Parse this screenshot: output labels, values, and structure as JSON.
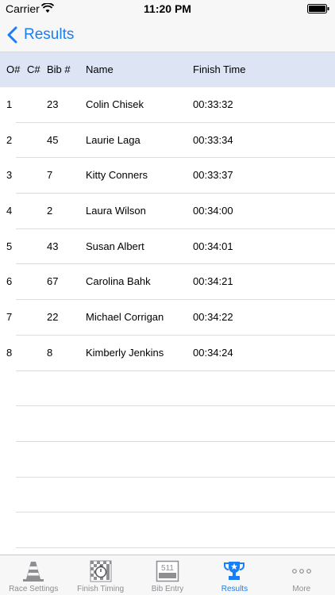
{
  "status_bar": {
    "carrier": "Carrier",
    "time": "11:20 PM"
  },
  "nav": {
    "back_label": "Results"
  },
  "table": {
    "headers": {
      "order": "O#",
      "class": "C#",
      "bib": "Bib #",
      "name": "Name",
      "finish_time": "Finish Time"
    },
    "rows": [
      {
        "order": "1",
        "class": "",
        "bib": "23",
        "name": "Colin Chisek",
        "finish_time": "00:33:32"
      },
      {
        "order": "2",
        "class": "",
        "bib": "45",
        "name": "Laurie Laga",
        "finish_time": "00:33:34"
      },
      {
        "order": "3",
        "class": "",
        "bib": "7",
        "name": "Kitty Conners",
        "finish_time": "00:33:37"
      },
      {
        "order": "4",
        "class": "",
        "bib": "2",
        "name": "Laura Wilson",
        "finish_time": "00:34:00"
      },
      {
        "order": "5",
        "class": "",
        "bib": "43",
        "name": "Susan Albert",
        "finish_time": "00:34:01"
      },
      {
        "order": "6",
        "class": "",
        "bib": "67",
        "name": "Carolina Bahk",
        "finish_time": "00:34:21"
      },
      {
        "order": "7",
        "class": "",
        "bib": "22",
        "name": "Michael Corrigan",
        "finish_time": "00:34:22"
      },
      {
        "order": "8",
        "class": "",
        "bib": "8",
        "name": "Kimberly  Jenkins",
        "finish_time": "00:34:24"
      }
    ]
  },
  "tab_bar": {
    "tabs": [
      {
        "label": "Race Settings",
        "icon": "traffic-cone-icon"
      },
      {
        "label": "Finish Timing",
        "icon": "checkered-stopwatch-icon"
      },
      {
        "label": "Bib Entry",
        "icon": "bib-number-icon",
        "icon_text": "511"
      },
      {
        "label": "Results",
        "icon": "trophy-icon"
      },
      {
        "label": "More",
        "icon": "more-dots-icon"
      }
    ],
    "active": "Results"
  },
  "colors": {
    "accent": "#1a7ef5",
    "header_bg": "#dde5f5",
    "inactive": "#8e8e93"
  }
}
